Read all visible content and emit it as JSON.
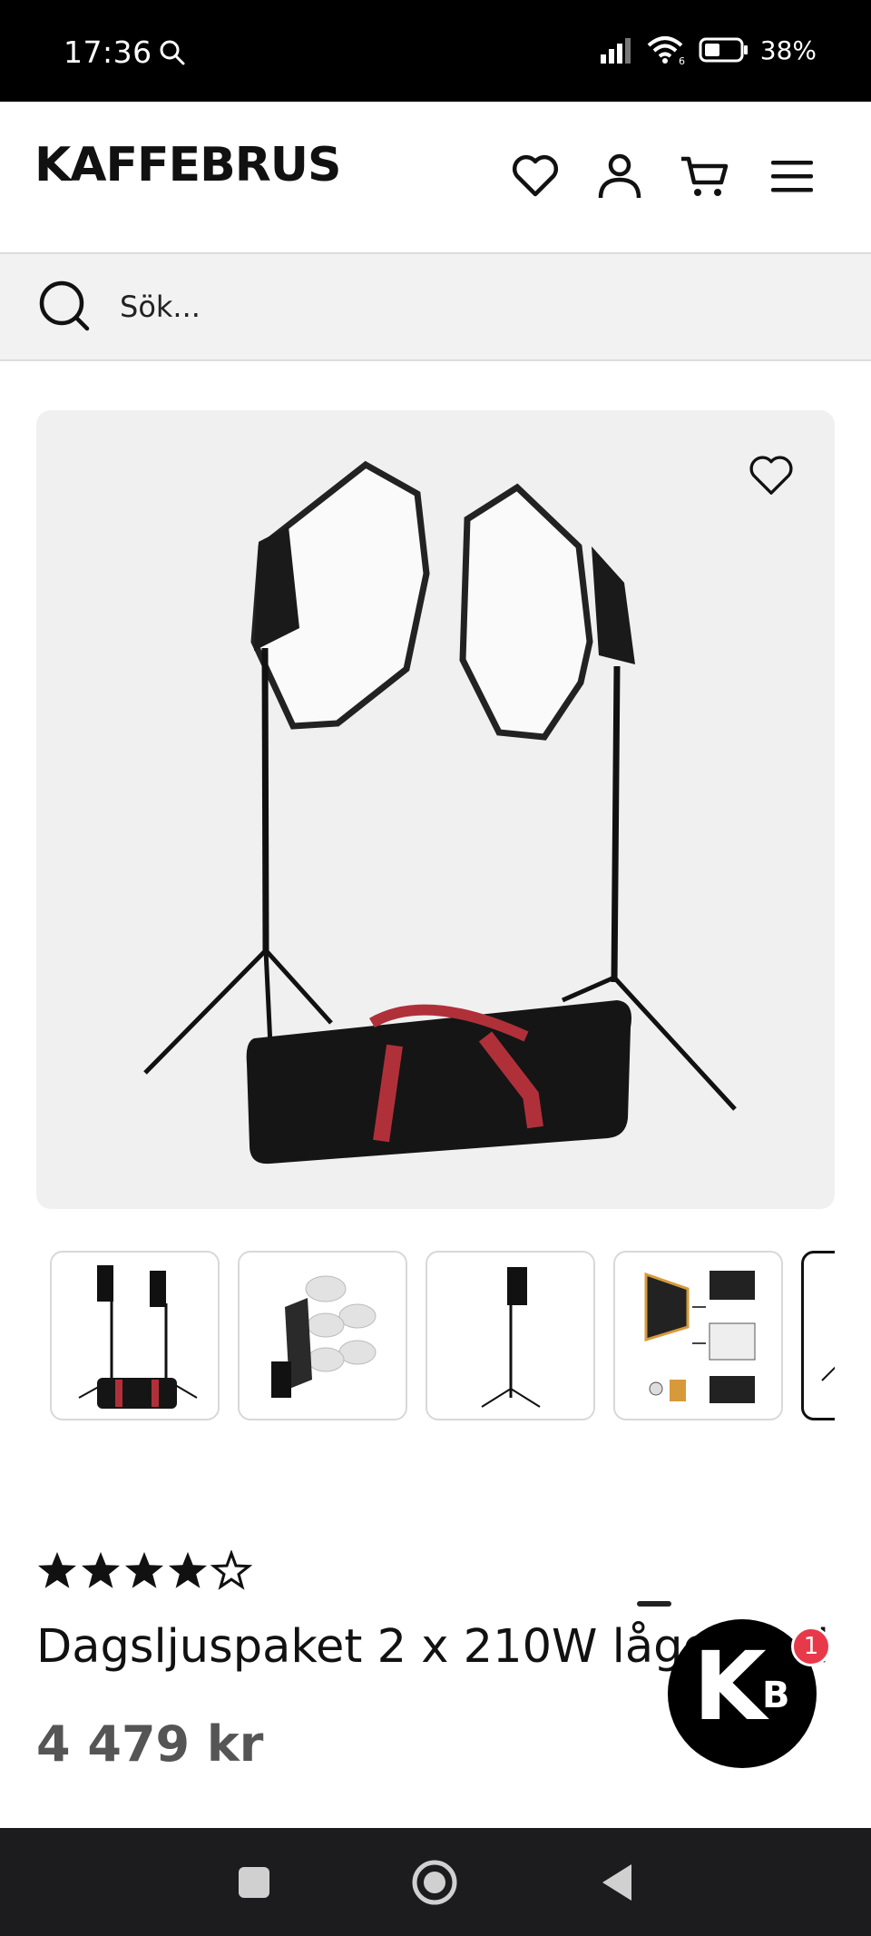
{
  "status_bar": {
    "time": "17:36",
    "battery": "38%",
    "wifi_label": "6"
  },
  "header": {
    "logo": "KAFFEBRUS",
    "icons": [
      "heart-icon",
      "user-icon",
      "cart-icon",
      "menu-icon"
    ]
  },
  "search": {
    "placeholder": "Sök..."
  },
  "product": {
    "rating": 4,
    "rating_max": 5,
    "title": "Dagsljuspaket 2 x 210W lågenergi",
    "price": "4 479 kr"
  },
  "chat": {
    "letter_main": "K",
    "letter_sub": "B",
    "badge_count": "1"
  },
  "colors": {
    "accent": "#e8394a",
    "text": "#111111",
    "price": "#555555",
    "image_bg": "#f0f0f0"
  }
}
